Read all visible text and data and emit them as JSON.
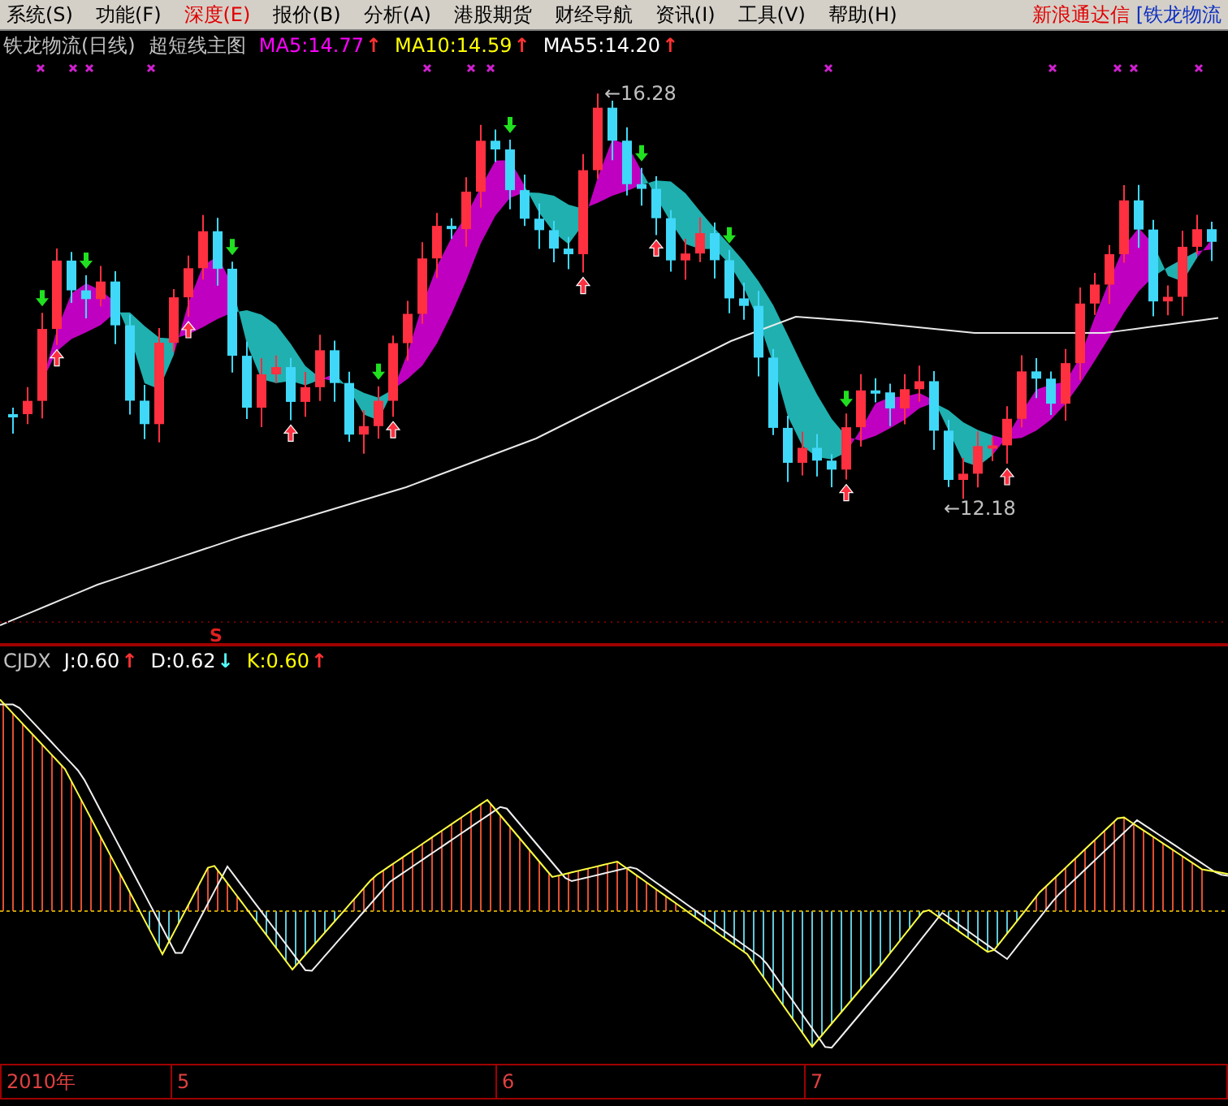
{
  "menu": {
    "items": [
      {
        "label": "系统(S)",
        "highlighted": false
      },
      {
        "label": "功能(F)",
        "highlighted": false
      },
      {
        "label": "深度(E)",
        "highlighted": true
      },
      {
        "label": "报价(B)",
        "highlighted": false
      },
      {
        "label": "分析(A)",
        "highlighted": false
      },
      {
        "label": "港股期货",
        "highlighted": false
      },
      {
        "label": "财经导航",
        "highlighted": false
      },
      {
        "label": "资讯(I)",
        "highlighted": false
      },
      {
        "label": "工具(V)",
        "highlighted": false
      },
      {
        "label": "帮助(H)",
        "highlighted": false
      }
    ],
    "brand": "新浪通达信",
    "window_caption": "[铁龙物流"
  },
  "main_chart": {
    "title": "铁龙物流(日线)",
    "formula": "超短线主图",
    "indicators": [
      {
        "label": "MA5:14.77",
        "color": "#ff00ff",
        "arrow": {
          "symbol": "↑",
          "color": "#ff3232"
        }
      },
      {
        "label": "MA10:14.59",
        "color": "#ffff00",
        "arrow": {
          "symbol": "↑",
          "color": "#ff3232"
        }
      },
      {
        "label": "MA55:14.20",
        "color": "#ffffff",
        "arrow": {
          "symbol": "↑",
          "color": "#ff3232"
        }
      }
    ],
    "high_label": "←16.28",
    "low_label": "←12.18",
    "signal_mark": "S"
  },
  "sub_chart": {
    "name": "CJDX",
    "indicators": [
      {
        "label": "J:0.60",
        "color": "#ffffff",
        "arrow": {
          "symbol": "↑",
          "color": "#ff3232"
        }
      },
      {
        "label": "D:0.62",
        "color": "#ffffff",
        "arrow": {
          "symbol": "↓",
          "color": "#54fcfc"
        }
      },
      {
        "label": "K:0.60",
        "color": "#ffff00",
        "arrow": {
          "symbol": "↑",
          "color": "#ff3232"
        }
      }
    ]
  },
  "time_axis": {
    "labels": [
      "2010年",
      "5",
      "6",
      "7"
    ]
  }
}
